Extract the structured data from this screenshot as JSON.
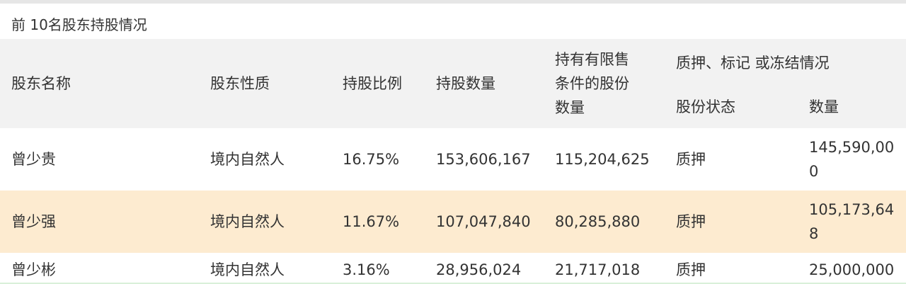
{
  "table_title": "前 10名股东持股情况",
  "headers": {
    "name": "股东名称",
    "nature": "股东性质",
    "ratio": "持股比例",
    "quantity": "持股数量",
    "restricted_line1": "持有有限售",
    "restricted_line2": "条件的股份",
    "restricted_line3": "数量",
    "pledge_group": "质押、标记 或冻结情况",
    "share_status": "股份状态",
    "pledge_quantity": "数量"
  },
  "rows": [
    {
      "name": "曾少贵",
      "nature": "境内自然人",
      "ratio": "16.75%",
      "quantity": "153,606,167",
      "restricted": "115,204,625",
      "status": "质押",
      "pledged": "145,590,000"
    },
    {
      "name": "曾少强",
      "nature": "境内自然人",
      "ratio": "11.67%",
      "quantity": "107,047,840",
      "restricted": "80,285,880",
      "status": "质押",
      "pledged": "105,173,648"
    },
    {
      "name": "曾少彬",
      "nature": "境内自然人",
      "ratio": "3.16%",
      "quantity": "28,956,024",
      "restricted": "21,717,018",
      "status": "质押",
      "pledged": "25,000,000"
    }
  ],
  "colors": {
    "header_bg": "#f2f2f2",
    "highlight_row_bg": "#fdebd0",
    "text": "#333333"
  }
}
